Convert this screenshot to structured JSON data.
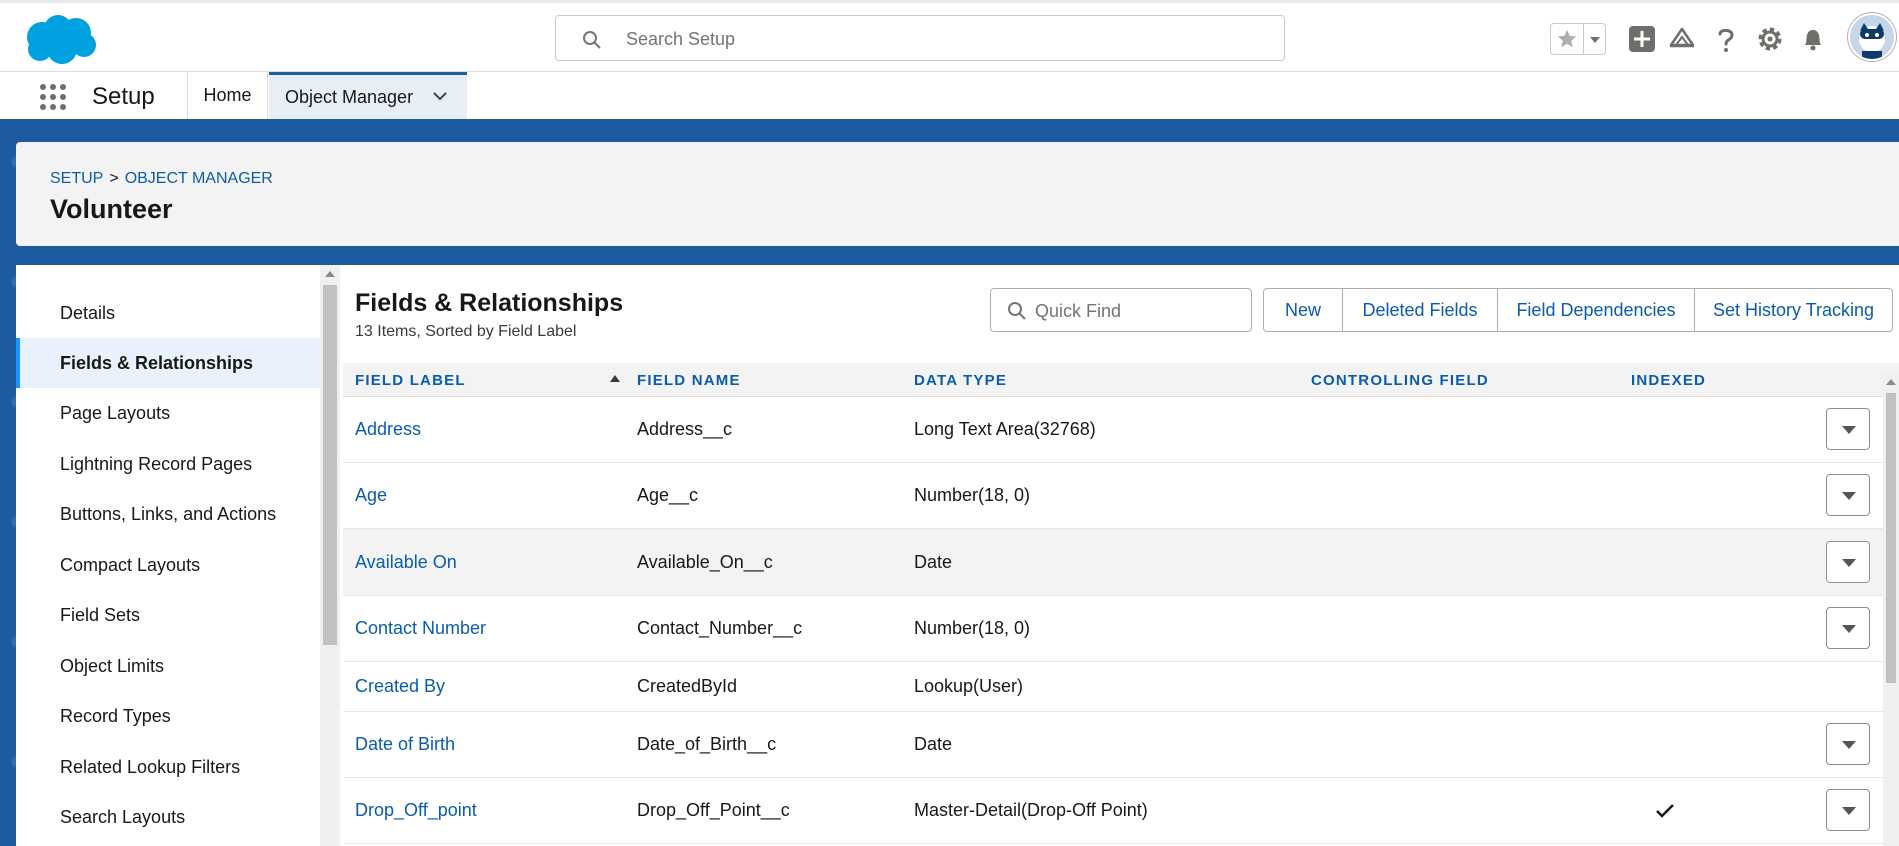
{
  "header": {
    "search_placeholder": "Search Setup",
    "icons": [
      "salesforce-cloud-logo",
      "favorites-star-icon",
      "global-actions-plus-icon",
      "trailhead-icon",
      "help-icon",
      "setup-gear-icon",
      "notifications-bell-icon",
      "user-avatar"
    ]
  },
  "nav": {
    "app_name": "Setup",
    "home_label": "Home",
    "object_manager_label": "Object Manager"
  },
  "page_header": {
    "breadcrumb_setup": "SETUP",
    "breadcrumb_sep": ">",
    "breadcrumb_object_manager": "OBJECT MANAGER",
    "title": "Volunteer"
  },
  "sidebar": {
    "items": [
      {
        "label": "Details"
      },
      {
        "label": "Fields & Relationships"
      },
      {
        "label": "Page Layouts"
      },
      {
        "label": "Lightning Record Pages"
      },
      {
        "label": "Buttons, Links, and Actions"
      },
      {
        "label": "Compact Layouts"
      },
      {
        "label": "Field Sets"
      },
      {
        "label": "Object Limits"
      },
      {
        "label": "Record Types"
      },
      {
        "label": "Related Lookup Filters"
      },
      {
        "label": "Search Layouts"
      }
    ],
    "active_index": 1
  },
  "main": {
    "title": "Fields & Relationships",
    "subtitle": "13 Items, Sorted by Field Label",
    "quick_find_placeholder": "Quick Find",
    "buttons": {
      "new": "New",
      "deleted_fields": "Deleted Fields",
      "field_dependencies": "Field Dependencies",
      "set_history_tracking": "Set History Tracking"
    }
  },
  "table": {
    "columns": {
      "field_label": "FIELD LABEL",
      "field_name": "FIELD NAME",
      "data_type": "DATA TYPE",
      "controlling_field": "CONTROLLING FIELD",
      "indexed": "INDEXED"
    },
    "rows": [
      {
        "label": "Address",
        "name": "Address__c",
        "type": "Long Text Area(32768)",
        "controlling": "",
        "indexed": false,
        "menu": true
      },
      {
        "label": "Age",
        "name": "Age__c",
        "type": "Number(18, 0)",
        "controlling": "",
        "indexed": false,
        "menu": true
      },
      {
        "label": "Available On",
        "name": "Available_On__c",
        "type": "Date",
        "controlling": "",
        "indexed": false,
        "menu": true
      },
      {
        "label": "Contact Number",
        "name": "Contact_Number__c",
        "type": "Number(18, 0)",
        "controlling": "",
        "indexed": false,
        "menu": true
      },
      {
        "label": "Created By",
        "name": "CreatedById",
        "type": "Lookup(User)",
        "controlling": "",
        "indexed": false,
        "menu": false
      },
      {
        "label": "Date of Birth",
        "name": "Date_of_Birth__c",
        "type": "Date",
        "controlling": "",
        "indexed": false,
        "menu": true
      },
      {
        "label": "Drop_Off_point",
        "name": "Drop_Off_Point__c",
        "type": "Master-Detail(Drop-Off Point)",
        "controlling": "",
        "indexed": true,
        "menu": true
      }
    ]
  },
  "colors": {
    "brand_blue": "#0b5cab",
    "band_blue": "#1e5aa0",
    "salesforce_cloud": "#00a1e0",
    "active_nav_bg": "#e8f1fc"
  }
}
